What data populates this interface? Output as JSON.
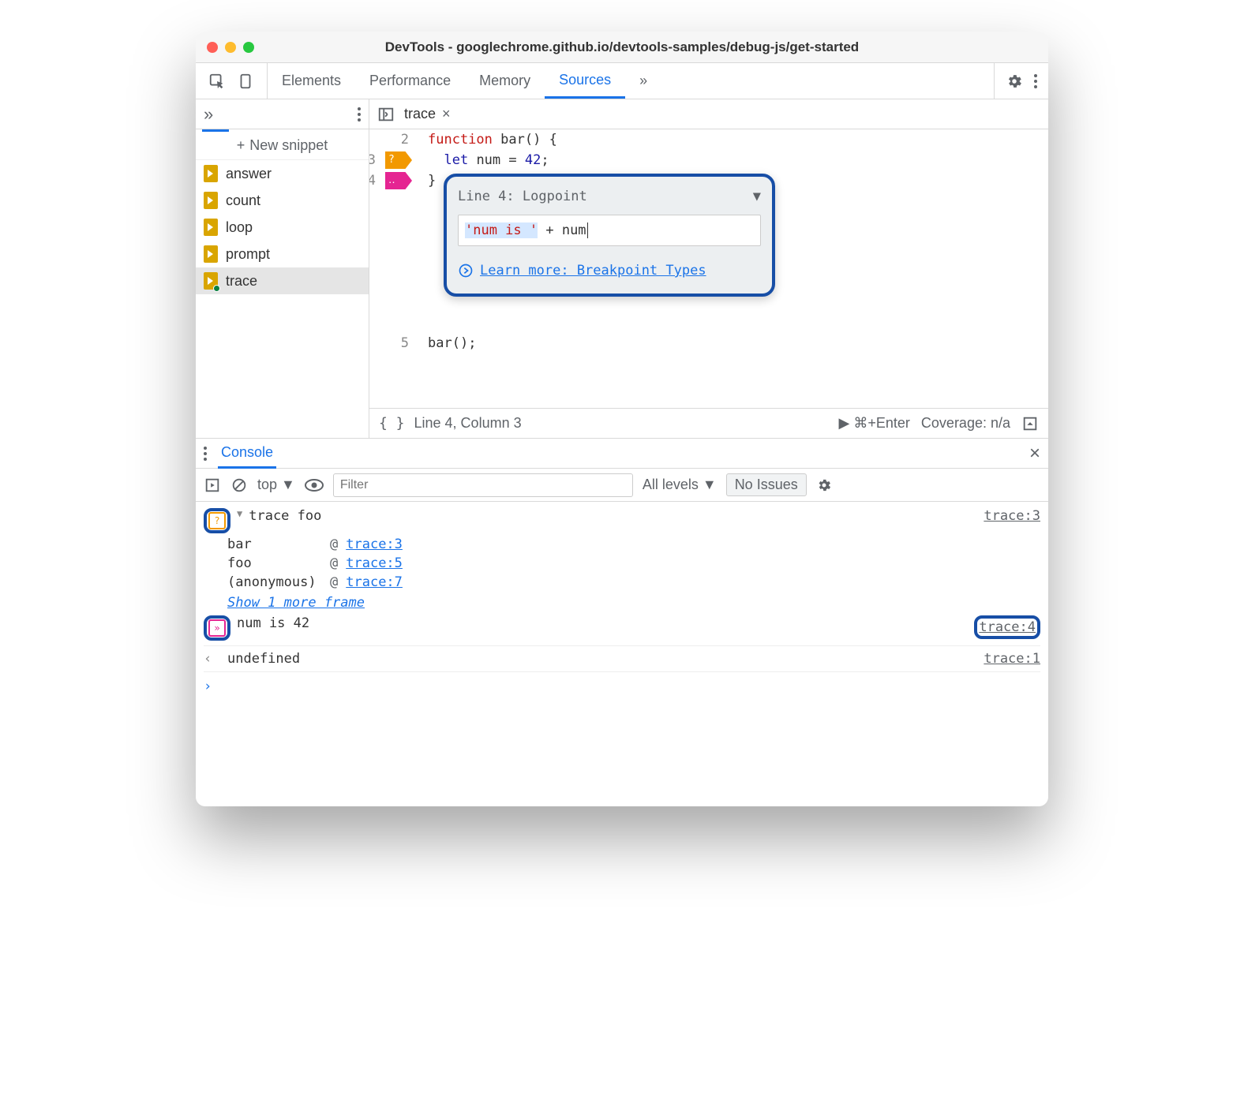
{
  "titlebar": {
    "title": "DevTools - googlechrome.github.io/devtools-samples/debug-js/get-started"
  },
  "tabs": {
    "items": [
      "Elements",
      "Performance",
      "Memory",
      "Sources"
    ],
    "active": "Sources",
    "more": "»"
  },
  "sidebar": {
    "chev": "»",
    "new_snippet": "New snippet",
    "plus": "+",
    "items": [
      {
        "name": "answer"
      },
      {
        "name": "count"
      },
      {
        "name": "loop"
      },
      {
        "name": "prompt"
      },
      {
        "name": "trace",
        "active": true
      }
    ]
  },
  "editor": {
    "open_tab": "trace",
    "close_x": "×",
    "lines": [
      {
        "n": "2",
        "html": "function bar() {"
      },
      {
        "n": "3",
        "marker": "orange",
        "marker_text": "?",
        "html": "  let num = 42;"
      },
      {
        "n": "4",
        "marker": "pink",
        "marker_text": "‥",
        "html": "}"
      },
      {
        "n": "5",
        "html": "bar();"
      }
    ],
    "popup": {
      "label": "Line 4:   Logpoint",
      "dropdown": "▼",
      "input_raw": "'num is ' + num",
      "link_text": "Learn more: Breakpoint Types"
    },
    "status": {
      "braces": "{ }",
      "pos": "Line 4, Column 3",
      "run_hint": "▶ ⌘+Enter",
      "coverage": "Coverage: n/a"
    }
  },
  "console": {
    "tab": "Console",
    "close": "×",
    "context": "top ▼",
    "filter_placeholder": "Filter",
    "levels": "All levels ▼",
    "issues": "No Issues",
    "entries": [
      {
        "type": "trace",
        "msg": "trace foo",
        "src": "trace:3",
        "stack": [
          {
            "fn": "bar",
            "loc": "trace:3"
          },
          {
            "fn": "foo",
            "loc": "trace:5"
          },
          {
            "fn": "(anonymous)",
            "loc": "trace:7"
          }
        ],
        "show_more": "Show 1 more frame"
      },
      {
        "type": "logpoint",
        "msg": "num is 42",
        "src": "trace:4",
        "src_ring": true
      },
      {
        "type": "return",
        "msg": "undefined",
        "src": "trace:1"
      }
    ]
  }
}
